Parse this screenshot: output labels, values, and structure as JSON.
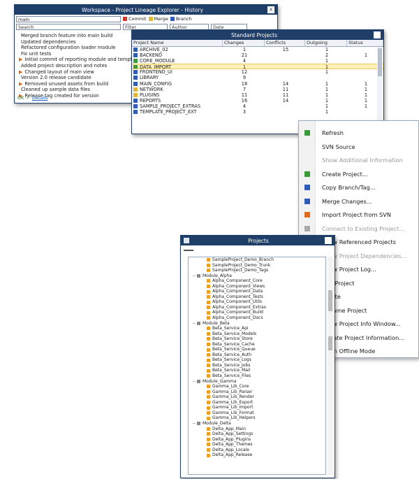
{
  "history_window": {
    "title": "Workspace - Project Lineage Explorer - History",
    "close_label": "X",
    "branch_selector": "main",
    "tags": [
      {
        "label": "Commit",
        "color": "#d33a2a"
      },
      {
        "label": "Merge",
        "color": "#e2b632"
      },
      {
        "label": "Branch",
        "color": "#2e5cb8"
      }
    ],
    "search_placeholder": "Search",
    "filters": [
      "Filter",
      "Author",
      "Date"
    ],
    "entries": [
      "Merged branch feature into main build",
      "Updated dependencies",
      "Refactored configuration loader module",
      "Fix unit tests",
      "Initial commit of reporting module and templates",
      "Added project description and notes",
      "Changed layout of main view",
      "Version 2.0 release candidate",
      "Removed unused assets from build",
      "Cleaned up sample data files",
      "Release tag created for version"
    ],
    "status_ok": "OK",
    "status_link": "Details"
  },
  "table_window": {
    "title": "Standard Projects",
    "columns": [
      "Project Name",
      "Changes",
      "Conflicts",
      "Outgoing",
      "Status"
    ],
    "rows": [
      {
        "name": "ARCHIVE_02",
        "changes": "1",
        "conflicts": "15",
        "outgoing": "1",
        "status": "",
        "icon": "blue"
      },
      {
        "name": "BACKEND",
        "changes": "21",
        "conflicts": "",
        "outgoing": "2",
        "status": "1",
        "icon": "blue"
      },
      {
        "name": "CORE_MODULE",
        "changes": "4",
        "conflicts": "",
        "outgoing": "1",
        "status": "",
        "icon": "green"
      },
      {
        "name": "DATA_IMPORT",
        "changes": "1",
        "conflicts": "",
        "outgoing": "1",
        "status": "",
        "icon": "green"
      },
      {
        "name": "FRONTEND_UI",
        "changes": "12",
        "conflicts": "",
        "outgoing": "1",
        "status": "",
        "icon": "blue"
      },
      {
        "name": "LIBRARY",
        "changes": "9",
        "conflicts": "",
        "outgoing": "",
        "status": "",
        "icon": "blue"
      },
      {
        "name": "MAIN_CONFIG",
        "changes": "18",
        "conflicts": "14",
        "outgoing": "1",
        "status": "1",
        "icon": "blue"
      },
      {
        "name": "NETWORK",
        "changes": "7",
        "conflicts": "11",
        "outgoing": "1",
        "status": "1",
        "icon": "yellow"
      },
      {
        "name": "PLUGINS",
        "changes": "11",
        "conflicts": "11",
        "outgoing": "1",
        "status": "1",
        "icon": "yellow"
      },
      {
        "name": "REPORTS",
        "changes": "16",
        "conflicts": "14",
        "outgoing": "1",
        "status": "1",
        "icon": "blue"
      },
      {
        "name": "SAMPLE_PROJECT_EXTRAS",
        "changes": "4",
        "conflicts": "",
        "outgoing": "1",
        "status": "1",
        "icon": "blue"
      },
      {
        "name": "TEMPLATE_PROJECT_EXT",
        "changes": "3",
        "conflicts": "",
        "outgoing": "1",
        "status": "",
        "icon": "blue"
      }
    ],
    "selected_index": 3
  },
  "context_menu": {
    "items": [
      {
        "label": "Refresh",
        "icon": "refresh-icon",
        "color": "#3a9a3a",
        "disabled": false
      },
      {
        "label": "SVN Source",
        "icon": "",
        "color": "",
        "disabled": false
      },
      {
        "label": "Show Additional Information",
        "icon": "",
        "color": "",
        "disabled": true
      },
      {
        "label": "Create Project...",
        "icon": "create-icon",
        "color": "#3a9a3a",
        "disabled": false
      },
      {
        "label": "Copy Branch/Tag...",
        "icon": "branch-icon",
        "color": "#2e5cb8",
        "disabled": false
      },
      {
        "label": "Merge Changes...",
        "icon": "merge-icon",
        "color": "#2e5cb8",
        "disabled": false
      },
      {
        "label": "Import Project from SVN",
        "icon": "import-icon",
        "color": "#e06b1a",
        "disabled": false
      },
      {
        "label": "Connect to Existing Project...",
        "icon": "connect-icon",
        "color": "#aaaaaa",
        "disabled": true
      },
      {
        "label": "Show Referenced Projects",
        "icon": "reference-icon",
        "color": "#333333",
        "disabled": false
      },
      {
        "label": "Show Project Dependencies...",
        "icon": "",
        "color": "",
        "disabled": true
      },
      {
        "label": "Show Project Log...",
        "icon": "",
        "color": "",
        "disabled": false
      },
      {
        "label": "Edit Project",
        "icon": "",
        "color": "",
        "disabled": false
      },
      {
        "label": "Delete",
        "icon": "",
        "color": "",
        "disabled": false
      },
      {
        "label": "Rename Project",
        "icon": "",
        "color": "",
        "disabled": false
      },
      {
        "label": "Show Project Info Window...",
        "icon": "",
        "color": "",
        "disabled": false
      },
      {
        "label": "Update Project Information...",
        "icon": "",
        "color": "",
        "disabled": false
      },
      {
        "label": "Open Offline Mode",
        "icon": "",
        "color": "",
        "disabled": false
      }
    ]
  },
  "projects_window": {
    "title": "Projects",
    "tree": [
      {
        "depth": 1,
        "label": "SampleProject_Demo_Branch",
        "kind": "ora"
      },
      {
        "depth": 1,
        "label": "SampleProject_Demo_Trunk",
        "kind": "ora"
      },
      {
        "depth": 1,
        "label": "SampleProject_Demo_Tags",
        "kind": "ora"
      },
      {
        "depth": 0,
        "label": "Module_Alpha",
        "kind": "gry"
      },
      {
        "depth": 1,
        "label": "Alpha_Component_Core",
        "kind": "ora"
      },
      {
        "depth": 1,
        "label": "Alpha_Component_Views",
        "kind": "ora"
      },
      {
        "depth": 1,
        "label": "Alpha_Component_Data",
        "kind": "ora"
      },
      {
        "depth": 1,
        "label": "Alpha_Component_Tests",
        "kind": "ora"
      },
      {
        "depth": 1,
        "label": "Alpha_Component_Utils",
        "kind": "ora"
      },
      {
        "depth": 1,
        "label": "Alpha_Component_Extras",
        "kind": "ora"
      },
      {
        "depth": 1,
        "label": "Alpha_Component_Build",
        "kind": "ora"
      },
      {
        "depth": 1,
        "label": "Alpha_Component_Docs",
        "kind": "ora"
      },
      {
        "depth": 0,
        "label": "Module_Beta",
        "kind": "gry"
      },
      {
        "depth": 1,
        "label": "Beta_Service_Api",
        "kind": "ora"
      },
      {
        "depth": 1,
        "label": "Beta_Service_Models",
        "kind": "ora"
      },
      {
        "depth": 1,
        "label": "Beta_Service_Store",
        "kind": "ora"
      },
      {
        "depth": 1,
        "label": "Beta_Service_Cache",
        "kind": "ora"
      },
      {
        "depth": 1,
        "label": "Beta_Service_Queue",
        "kind": "ora"
      },
      {
        "depth": 1,
        "label": "Beta_Service_Auth",
        "kind": "ora"
      },
      {
        "depth": 1,
        "label": "Beta_Service_Logs",
        "kind": "ora"
      },
      {
        "depth": 1,
        "label": "Beta_Service_Jobs",
        "kind": "ora"
      },
      {
        "depth": 1,
        "label": "Beta_Service_Mail",
        "kind": "ora"
      },
      {
        "depth": 1,
        "label": "Beta_Service_Files",
        "kind": "ora"
      },
      {
        "depth": 0,
        "label": "Module_Gamma",
        "kind": "gry"
      },
      {
        "depth": 1,
        "label": "Gamma_Lib_Core",
        "kind": "ora"
      },
      {
        "depth": 1,
        "label": "Gamma_Lib_Parser",
        "kind": "ora"
      },
      {
        "depth": 1,
        "label": "Gamma_Lib_Render",
        "kind": "ora"
      },
      {
        "depth": 1,
        "label": "Gamma_Lib_Export",
        "kind": "ora"
      },
      {
        "depth": 1,
        "label": "Gamma_Lib_Import",
        "kind": "ora"
      },
      {
        "depth": 1,
        "label": "Gamma_Lib_Format",
        "kind": "ora"
      },
      {
        "depth": 1,
        "label": "Gamma_Lib_Helpers",
        "kind": "ora"
      },
      {
        "depth": 0,
        "label": "Module_Delta",
        "kind": "gry"
      },
      {
        "depth": 1,
        "label": "Delta_App_Main",
        "kind": "ora"
      },
      {
        "depth": 1,
        "label": "Delta_App_Settings",
        "kind": "ora"
      },
      {
        "depth": 1,
        "label": "Delta_App_Plugins",
        "kind": "ora"
      },
      {
        "depth": 1,
        "label": "Delta_App_Themes",
        "kind": "ora"
      },
      {
        "depth": 1,
        "label": "Delta_App_Locale",
        "kind": "ora"
      },
      {
        "depth": 1,
        "label": "Delta_App_Release",
        "kind": "ora"
      }
    ]
  }
}
